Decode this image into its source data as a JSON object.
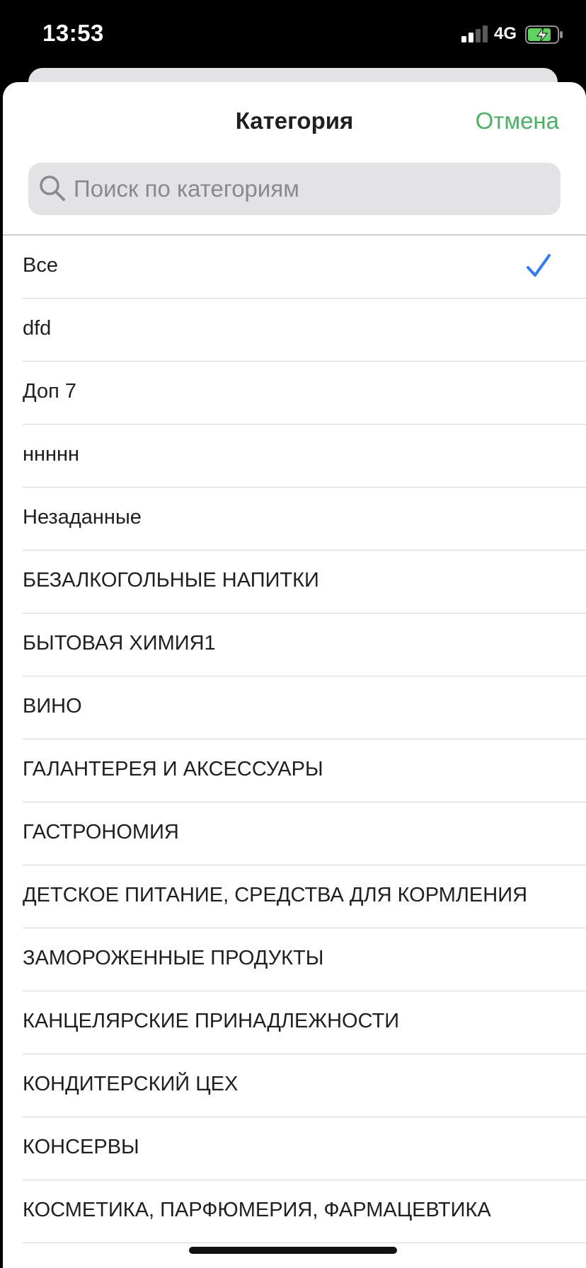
{
  "status_bar": {
    "time": "13:53",
    "network": "4G",
    "icons": [
      "signal-icon",
      "battery-charging-icon"
    ]
  },
  "sheet": {
    "title": "Категория",
    "cancel_label": "Отмена",
    "search": {
      "placeholder": "Поиск по категориям",
      "value": ""
    },
    "selected_index": 0,
    "categories": [
      "Все",
      "dfd",
      "Доп 7",
      "ннннн",
      "Незаданные",
      "БЕЗАЛКОГОЛЬНЫЕ НАПИТКИ",
      "БЫТОВАЯ ХИМИЯ1",
      "ВИНО",
      "ГАЛАНТЕРЕЯ И АКСЕССУАРЫ",
      "ГАСТРОНОМИЯ",
      "ДЕТСКОЕ ПИТАНИЕ, СРЕДСТВА ДЛЯ КОРМЛЕНИЯ",
      "ЗАМОРОЖЕННЫЕ ПРОДУКТЫ",
      "КАНЦЕЛЯРСКИЕ ПРИНАДЛЕЖНОСТИ",
      "КОНДИТЕРСКИЙ ЦЕХ",
      "КОНСЕРВЫ",
      "КОСМЕТИКА, ПАРФЮМЕРИЯ, ФАРМАЦЕВТИКА"
    ]
  },
  "colors": {
    "accent_green": "#4caf66",
    "check_blue": "#2f7cf6",
    "separator": "#d6d6d8"
  }
}
